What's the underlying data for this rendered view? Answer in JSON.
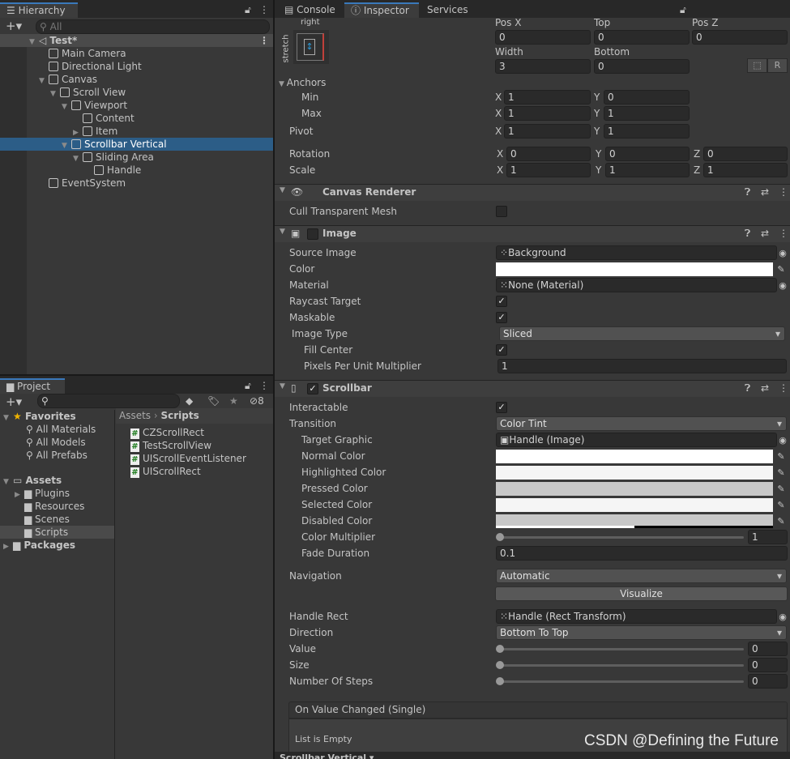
{
  "hierarchy": {
    "tab_label": "Hierarchy",
    "search_placeholder": "All",
    "scene": "Test*",
    "items": [
      {
        "label": "Main Camera",
        "depth": 0,
        "arrow": ""
      },
      {
        "label": "Directional Light",
        "depth": 0,
        "arrow": ""
      },
      {
        "label": "Canvas",
        "depth": 0,
        "arrow": "expanded"
      },
      {
        "label": "Scroll View",
        "depth": 1,
        "arrow": "expanded"
      },
      {
        "label": "Viewport",
        "depth": 2,
        "arrow": "expanded"
      },
      {
        "label": "Content",
        "depth": 3,
        "arrow": ""
      },
      {
        "label": "Item",
        "depth": 3,
        "arrow": "collapsed"
      },
      {
        "label": "Scrollbar Vertical",
        "depth": 2,
        "arrow": "expanded",
        "selected": true
      },
      {
        "label": "Sliding Area",
        "depth": 3,
        "arrow": "expanded"
      },
      {
        "label": "Handle",
        "depth": 4,
        "arrow": ""
      },
      {
        "label": "EventSystem",
        "depth": 0,
        "arrow": ""
      }
    ]
  },
  "project": {
    "tab_label": "Project",
    "hidden_count": "8",
    "favorites_label": "Favorites",
    "favorites": [
      "All Materials",
      "All Models",
      "All Prefabs"
    ],
    "assets_label": "Assets",
    "folders": [
      "Plugins",
      "Resources",
      "Scenes",
      "Scripts"
    ],
    "packages_label": "Packages",
    "breadcrumb": [
      "Assets",
      "Scripts"
    ],
    "files": [
      "CZScrollRect",
      "TestScrollView",
      "UIScrollEventListener",
      "UIScrollRect"
    ]
  },
  "tabs": {
    "console": "Console",
    "inspector": "Inspector",
    "services": "Services"
  },
  "rect": {
    "anchor_h": "right",
    "anchor_v": "stretch",
    "posx_label": "Pos X",
    "posx": "0",
    "top_label": "Top",
    "top": "0",
    "posz_label": "Pos Z",
    "posz": "0",
    "width_label": "Width",
    "width": "3",
    "bottom_label": "Bottom",
    "bottom": "0",
    "r_button": "R",
    "anchors_label": "Anchors",
    "min_label": "Min",
    "min_x": "1",
    "min_y": "0",
    "max_label": "Max",
    "max_x": "1",
    "max_y": "1",
    "pivot_label": "Pivot",
    "pivot_x": "1",
    "pivot_y": "1",
    "rotation_label": "Rotation",
    "rot_x": "0",
    "rot_y": "0",
    "rot_z": "0",
    "scale_label": "Scale",
    "scale_x": "1",
    "scale_y": "1",
    "scale_z": "1",
    "x": "X",
    "y": "Y",
    "z": "Z"
  },
  "canvas_renderer": {
    "title": "Canvas Renderer",
    "cull_label": "Cull Transparent Mesh",
    "cull": false
  },
  "image": {
    "title": "Image",
    "enabled": false,
    "source_label": "Source Image",
    "source": "Background",
    "color_label": "Color",
    "color": "#ffffff",
    "material_label": "Material",
    "material": "None (Material)",
    "raycast_label": "Raycast Target",
    "raycast": true,
    "maskable_label": "Maskable",
    "maskable": true,
    "type_label": "Image Type",
    "type": "Sliced",
    "fill_label": "Fill Center",
    "fill": true,
    "ppu_label": "Pixels Per Unit Multiplier",
    "ppu": "1"
  },
  "scrollbar": {
    "title": "Scrollbar",
    "enabled": true,
    "interactable_label": "Interactable",
    "interactable": true,
    "transition_label": "Transition",
    "transition": "Color Tint",
    "target_label": "Target Graphic",
    "target": "Handle (Image)",
    "normal_label": "Normal Color",
    "normal": "#ffffff",
    "highlighted_label": "Highlighted Color",
    "highlighted": "#f5f5f5",
    "pressed_label": "Pressed Color",
    "pressed": "#c8c8c8",
    "selected_label": "Selected Color",
    "selected": "#f5f5f5",
    "disabled_label": "Disabled Color",
    "disabled": "#c8c8c8",
    "multiplier_label": "Color Multiplier",
    "multiplier": "1",
    "fade_label": "Fade Duration",
    "fade": "0.1",
    "navigation_label": "Navigation",
    "navigation": "Automatic",
    "visualize": "Visualize",
    "handle_label": "Handle Rect",
    "handle": "Handle (Rect Transform)",
    "direction_label": "Direction",
    "direction": "Bottom To Top",
    "value_label": "Value",
    "value": "0",
    "size_label": "Size",
    "size": "0",
    "steps_label": "Number Of Steps",
    "steps": "0",
    "event_title": "On Value Changed (Single)",
    "event_empty": "List is Empty"
  },
  "footer": {
    "object": "Scrollbar Vertical ▾"
  },
  "watermark": "CSDN @Defining the Future"
}
